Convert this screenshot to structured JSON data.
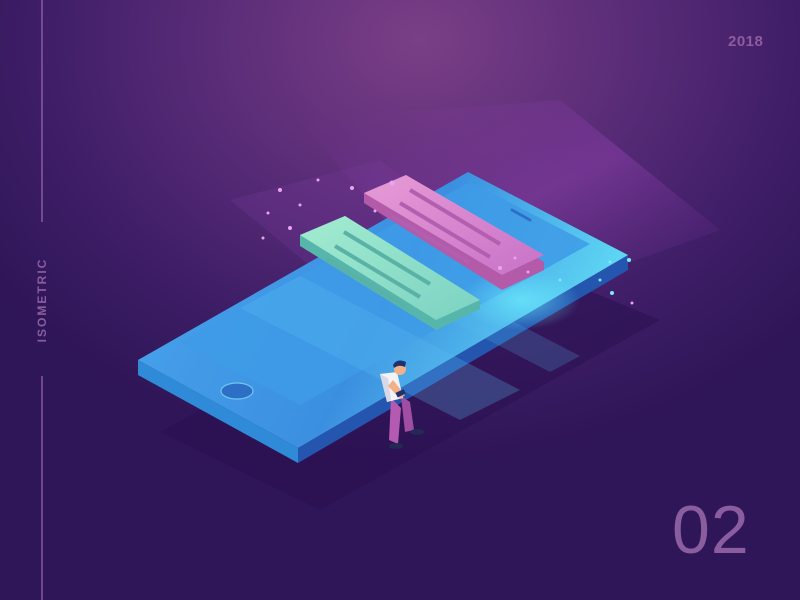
{
  "side_label": "ISOMETRIC",
  "year": "2018",
  "number": "02",
  "colors": {
    "background": "#3d1d66",
    "phone_screen": "#3fa0e6",
    "phone_edge": "#2a6fc2",
    "card_green": "#8fe2c6",
    "card_pink": "#e086c8",
    "glow": "#b45dd6",
    "label_text": "#8a5d9e"
  },
  "illustration": {
    "subject": "isometric smartphone with two floating message cards",
    "figure": "person sitting on phone edge looking at a device",
    "icons": [
      "smartphone-icon",
      "message-card-icon",
      "person-figure"
    ]
  }
}
